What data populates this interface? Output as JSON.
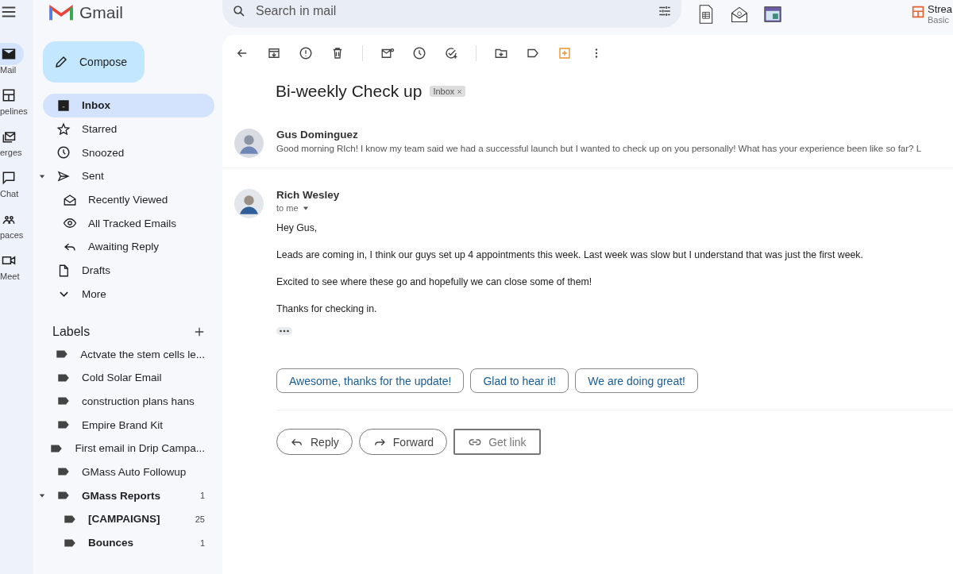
{
  "app": {
    "logo_text": "Gmail",
    "search": {
      "placeholder": "Search in mail"
    },
    "extension": {
      "name": "Strea",
      "plan": "Basic"
    }
  },
  "rail": [
    {
      "label": "Mail",
      "selected": true
    },
    {
      "label": "pelines",
      "selected": false
    },
    {
      "label": "erges",
      "selected": false
    },
    {
      "label": "Chat",
      "selected": false
    },
    {
      "label": "paces",
      "selected": false
    },
    {
      "label": "Meet",
      "selected": false
    }
  ],
  "compose": "Compose",
  "nav": [
    {
      "label": "Inbox",
      "selected": true
    },
    {
      "label": "Starred",
      "selected": false
    },
    {
      "label": "Snoozed",
      "selected": false
    },
    {
      "label": "Sent",
      "selected": false,
      "expanded": true,
      "children": [
        {
          "label": "Recently Viewed",
          "selected": false
        },
        {
          "label": "All Tracked Emails",
          "selected": false
        },
        {
          "label": "Awaiting Reply",
          "selected": false
        }
      ]
    },
    {
      "label": "Drafts",
      "selected": false
    },
    {
      "label": "More",
      "selected": false
    }
  ],
  "labels_title": "Labels",
  "labels": [
    {
      "name": "Actvate the stem cells le...",
      "unread": false
    },
    {
      "name": "Cold Solar Email",
      "unread": false
    },
    {
      "name": "construction plans hans",
      "unread": false
    },
    {
      "name": "Empire Brand Kit",
      "unread": false
    },
    {
      "name": "First email in Drip Campa...",
      "unread": false
    },
    {
      "name": "GMass Auto Followup",
      "unread": false
    },
    {
      "name": "GMass Reports",
      "unread": true,
      "count": "1",
      "expanded": true,
      "children": [
        {
          "name": "[CAMPAIGNS]",
          "unread": true,
          "count": "25"
        },
        {
          "name": "Bounces",
          "unread": true,
          "count": "1"
        }
      ]
    }
  ],
  "thread": {
    "subject": "Bi-weekly Check up",
    "tag": "Inbox",
    "collapsed": {
      "sender": "Gus Dominguez",
      "snippet": "Good morning RIch! I know my team said we had a successful launch but I wanted to check up on you personally! What has your experience been like so far? L"
    },
    "message": {
      "sender": "Rich Wesley",
      "recipient": "to me",
      "paragraphs": [
        "Hey Gus,",
        "Leads are coming in, I think our guys set up 4 appointments this week. Last week was slow but I understand that was just the first week.",
        "Excited to see where these go and hopefully we can close some of them!",
        "Thanks for checking in."
      ]
    },
    "smart_replies": [
      "Awesome, thanks for the update!",
      "Glad to hear it!",
      "We are doing great!"
    ],
    "actions": [
      {
        "label": "Reply",
        "kind": "reply"
      },
      {
        "label": "Forward",
        "kind": "forward"
      },
      {
        "label": "Get link",
        "kind": "link"
      }
    ]
  }
}
